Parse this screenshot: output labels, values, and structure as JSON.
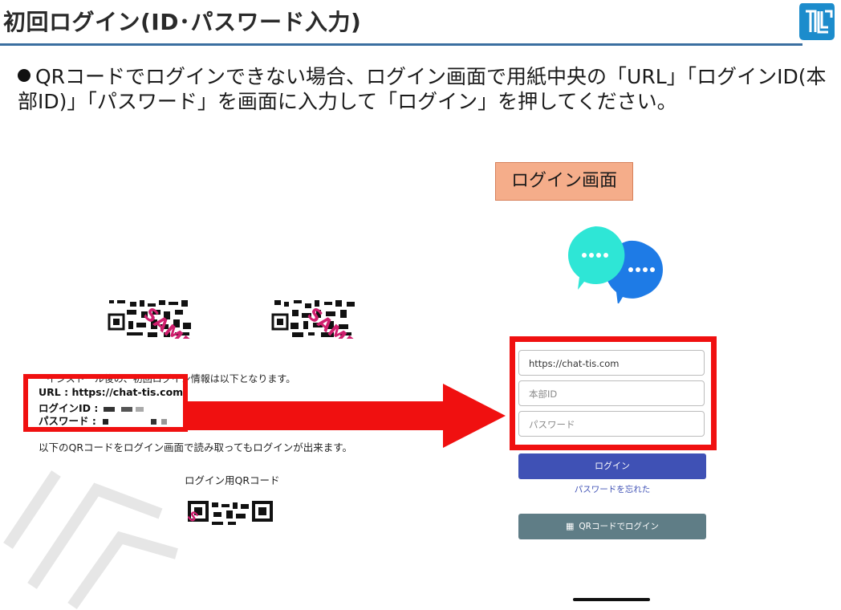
{
  "page": {
    "title": "初回ログイン(ID･パスワード入力)",
    "bullet": "QRコードでログインできない場合、ログイン画面で用紙中央の「URL」「ログインID(本部ID)」「パスワード」を画面に入力して「ログイン」を押してください。"
  },
  "left_sheet": {
    "info_text": "インストール後の、初回ログイン情報は以下となります。",
    "url_line": "URL : https://chat-tis.com",
    "id_label": "ログインID :",
    "password_label": "パスワード :",
    "note": "以下のQRコードをログイン画面で読み取ってもログインが出来ます。",
    "qr_caption": "ログイン用QRコード"
  },
  "login_screen": {
    "label": "ログイン画面",
    "url_value": "https://chat-tis.com",
    "id_placeholder": "本部ID",
    "password_placeholder": "パスワード",
    "login_button": "ログイン",
    "forgot_link": "パスワードを忘れた",
    "qr_login_button": "QRコードでログイン",
    "qr_icon": "qr-code-icon"
  },
  "colors": {
    "highlight_red": "#f01010",
    "login_button": "#3f51b5",
    "qr_button": "#5f7d86",
    "label_bg": "#f5ad8a",
    "bubble_cyan": "#2ee6d6",
    "bubble_blue": "#1e7be6"
  }
}
